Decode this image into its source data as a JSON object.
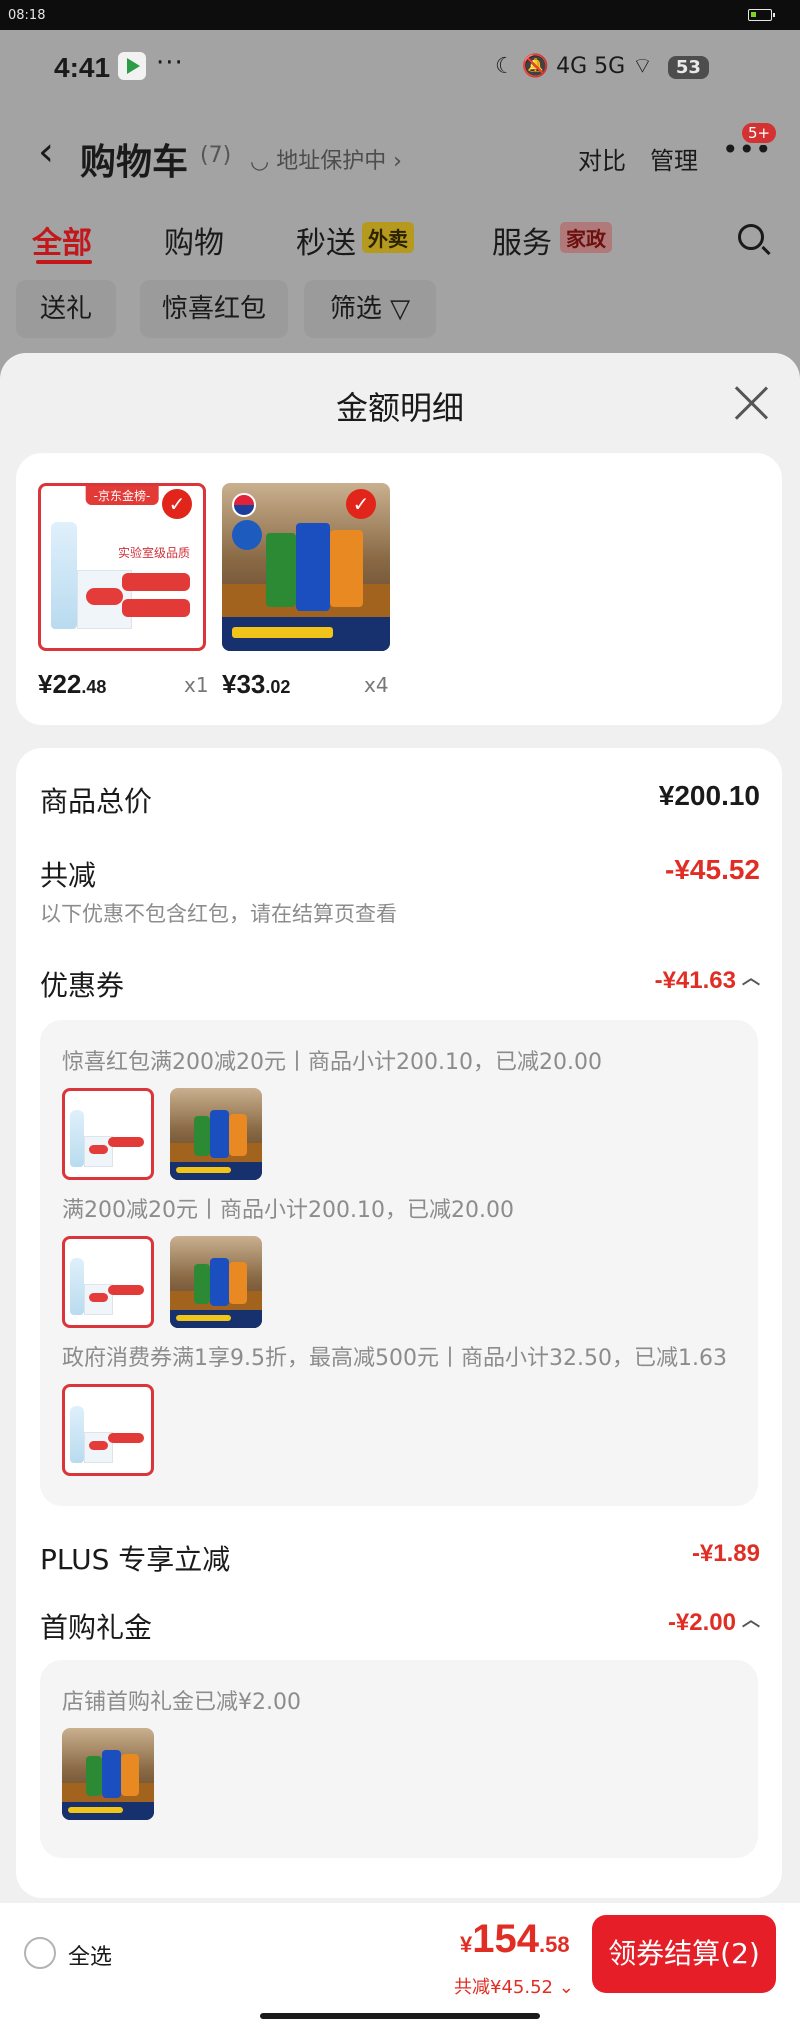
{
  "outer_status": {
    "time": "08:18"
  },
  "phone_status": {
    "time": "4:41",
    "more": "···",
    "icons": "☾ 🔕 4G 5G ⌔",
    "battery": "53"
  },
  "nav": {
    "back": "‹",
    "title": "购物车",
    "count": "(7)",
    "address": "◡ 地址保护中 ›",
    "compare": "对比",
    "manage": "管理",
    "more": "•••",
    "badge": "5+"
  },
  "tabs": [
    {
      "label": "全部"
    },
    {
      "label": "购物"
    },
    {
      "label": "秒送",
      "tag": "外卖"
    },
    {
      "label": "服务",
      "tag": "家政"
    }
  ],
  "chips": [
    "送礼",
    "惊喜红包",
    "筛选 ▽"
  ],
  "sheet": {
    "title": "金额明细"
  },
  "products": [
    {
      "name": "water",
      "banner": "-京东金榜-",
      "text": "实验室级品质",
      "price_int": "¥22",
      "price_dec": ".48",
      "qty": "x1"
    },
    {
      "name": "pepsi",
      "price_int": "¥33",
      "price_dec": ".02",
      "qty": "x4"
    }
  ],
  "summary": {
    "total_label": "商品总价",
    "total_value": "¥200.10",
    "reduce_label": "共减",
    "reduce_value": "-¥45.52",
    "note": "以下优惠不包含红包，请在结算页查看",
    "coupon_label": "优惠券",
    "coupon_value": "-¥41.63",
    "plus_label": "PLUS 专享立减",
    "plus_value": "-¥1.89",
    "gift_label": "首购礼金",
    "gift_value": "-¥2.00"
  },
  "coupons": [
    "惊喜红包满200减20元丨商品小计200.10，已减20.00",
    "满200减20元丨商品小计200.10，已减20.00",
    "政府消费券满1享9.5折，最高减500元丨商品小计32.50，已减1.63"
  ],
  "gift_detail": "店铺首购礼金已减¥2.00",
  "bottom": {
    "select_all": "全选",
    "total_yen": "¥",
    "total_int": "154",
    "total_dec": ".58",
    "discount": "共减¥45.52 ⌄",
    "checkout": "领券结算(2)"
  },
  "colors": {
    "accent": "#e02e24",
    "checkout": "#e61e28"
  }
}
